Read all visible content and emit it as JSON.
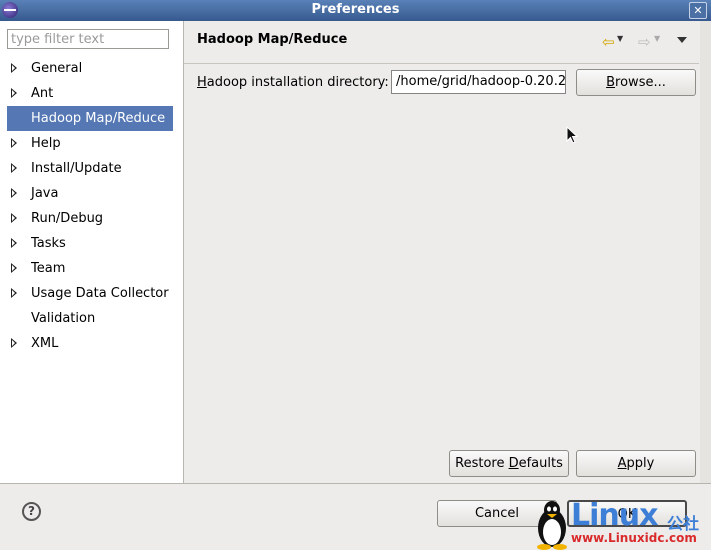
{
  "window": {
    "title": "Preferences",
    "close_glyph": "✕"
  },
  "sidebar": {
    "filter_placeholder": "type filter text",
    "items": [
      {
        "label": "General",
        "expandable": true
      },
      {
        "label": "Ant",
        "expandable": true
      },
      {
        "label": "Hadoop Map/Reduce",
        "expandable": false,
        "selected": true
      },
      {
        "label": "Help",
        "expandable": true
      },
      {
        "label": "Install/Update",
        "expandable": true
      },
      {
        "label": "Java",
        "expandable": true
      },
      {
        "label": "Run/Debug",
        "expandable": true
      },
      {
        "label": "Tasks",
        "expandable": true
      },
      {
        "label": "Team",
        "expandable": true
      },
      {
        "label": "Usage Data Collector",
        "expandable": true
      },
      {
        "label": "Validation",
        "expandable": false
      },
      {
        "label": "XML",
        "expandable": true
      }
    ]
  },
  "page": {
    "title": "Hadoop Map/Reduce",
    "field_label_mnemonic": "H",
    "field_label_rest": "adoop installation directory:",
    "field_value": "/home/grid/hadoop-0.20.2",
    "browse_mnemonic": "B",
    "browse_rest": "rowse...",
    "restore_prefix": "Restore ",
    "restore_mnemonic": "D",
    "restore_rest": "efaults",
    "apply_mnemonic": "A",
    "apply_rest": "pply"
  },
  "footer": {
    "help_glyph": "?",
    "cancel_label": "Cancel",
    "ok_label": "OK"
  },
  "watermark": {
    "brand": "Linux",
    "cn": "公社",
    "url": "www.Linuxidc.com"
  },
  "colors": {
    "titlebar": "#36598e",
    "selection": "#5578b4",
    "watermark_blue": "#3d7fd6",
    "watermark_red": "#d92b2b"
  },
  "icons": [
    "eclipse-icon",
    "close-icon",
    "back-arrow-icon",
    "forward-arrow-icon",
    "view-menu-icon",
    "help-icon",
    "expand-arrow-icon",
    "mouse-cursor-icon"
  ]
}
